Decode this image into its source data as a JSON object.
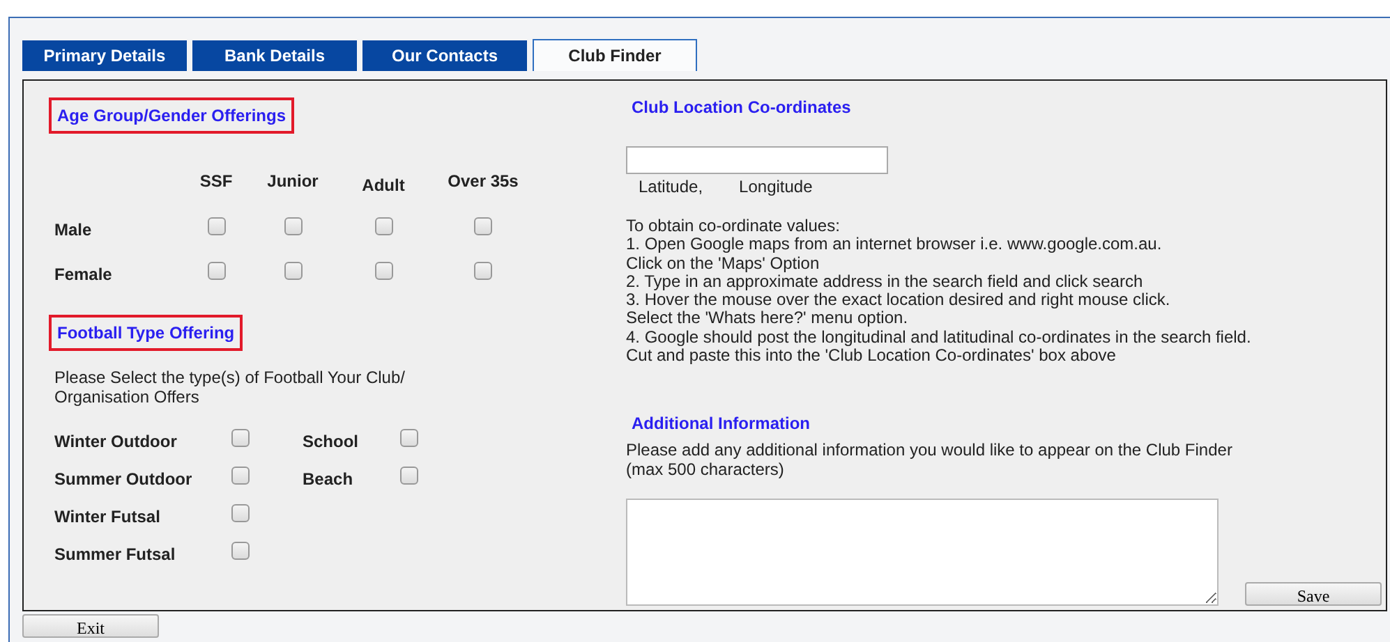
{
  "tabs": [
    {
      "label": "Primary Details",
      "selected": false
    },
    {
      "label": "Bank Details",
      "selected": false
    },
    {
      "label": "Our Contacts",
      "selected": false
    },
    {
      "label": "Club Finder",
      "selected": true
    }
  ],
  "age_group": {
    "heading": "Age Group/Gender Offerings",
    "highlighted": true,
    "columns": [
      "SSF",
      "Junior",
      "Adult",
      "Over 35s"
    ],
    "rows": [
      {
        "label": "Male",
        "checks": [
          false,
          false,
          false,
          false
        ]
      },
      {
        "label": "Female",
        "checks": [
          false,
          false,
          false,
          false
        ]
      }
    ]
  },
  "football_type": {
    "heading": "Football Type Offering",
    "highlighted": true,
    "instruction": "Please Select the type(s) of Football Your Club/ Organisation Offers",
    "option_rows": [
      [
        {
          "label": "Winter Outdoor",
          "checked": false
        },
        {
          "label": "School",
          "checked": false
        }
      ],
      [
        {
          "label": "Summer Outdoor",
          "checked": false
        },
        {
          "label": "Beach",
          "checked": false
        }
      ],
      [
        {
          "label": "Winter Futsal",
          "checked": false
        }
      ],
      [
        {
          "label": "Summer Futsal",
          "checked": false
        }
      ]
    ]
  },
  "location": {
    "heading": "Club Location Co-ordinates",
    "highlighted": false,
    "field_labels": [
      "Latitude,",
      "Longitude"
    ],
    "instructions": [
      "To obtain co-ordinate values:",
      "1. Open Google maps from an internet browser i.e. www.google.com.au.",
      "Click on the 'Maps' Option",
      "2. Type in an approximate address in the search field and click search",
      "3. Hover the mouse over the exact location desired and right mouse click.",
      "Select the 'Whats here?' menu option.",
      "4. Google should post the longitudinal and latitudinal co-ordinates in the search field.",
      "Cut and paste this into the 'Club Location Co-ordinates' box above"
    ]
  },
  "additional": {
    "heading": "Additional Information",
    "highlighted": false,
    "description": "Please add any additional information you would like to appear on the Club Finder (max 500 characters)"
  },
  "buttons": {
    "save": "Save",
    "exit": "Exit"
  }
}
